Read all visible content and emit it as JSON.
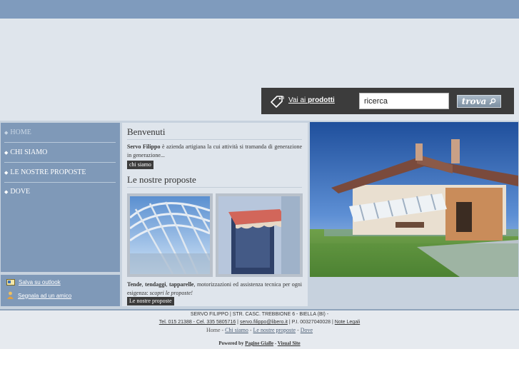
{
  "search": {
    "products_label_prefix": "Vai ai ",
    "products_label_bold": "prodotti",
    "input_value": "ricerca",
    "button_label": "trova"
  },
  "nav": {
    "items": [
      {
        "label": "HOME"
      },
      {
        "label": "CHI SIAMO"
      },
      {
        "label": "LE NOSTRE PROPOSTE"
      },
      {
        "label": "DOVE"
      }
    ]
  },
  "tools": {
    "outlook_label": "Salva su outlook",
    "friend_label": "Segnala ad un amico"
  },
  "content": {
    "welcome_title": "Benvenuti",
    "welcome_bold": "Servo Filippo",
    "welcome_text": " è azienda artigiana la cui attività si tramanda di generazione in generazione...",
    "about_button": "chi siamo",
    "proposals_title": "Le nostre proposte",
    "proposals_b1": "Tende",
    "proposals_b2": "tendaggi",
    "proposals_b3": "tapparelle",
    "proposals_text": ", motorizzazioni ed assistenza tecnica per ogni esigenza: ",
    "proposals_italic": "scopri le proposte!",
    "proposals_button": "Le nostre proposte"
  },
  "footer": {
    "address": "SERVO FILIPPO | STR. CASC. TREBBIONE 6 - BIELLA (BI) -",
    "phone": "Tel. 015 21388 - Cel. 335 5805716",
    "email": "servo.filippo@libero.it",
    "vat": "P.I. 00327040028",
    "legal": "Note Legali",
    "links": {
      "home": "Home",
      "about": "Chi siamo",
      "proposals": "Le nostre proposte",
      "where": "Dove"
    },
    "powered_by": "Powered by",
    "pagine_gialle": "Pagine Gialle",
    "visual_site": "Visual Site"
  },
  "colors": {
    "top_band": "#7f9bbd",
    "header_bg": "#dfe5ec",
    "sidebar": "#7f99b8",
    "search_bar": "#3c3c3c"
  }
}
